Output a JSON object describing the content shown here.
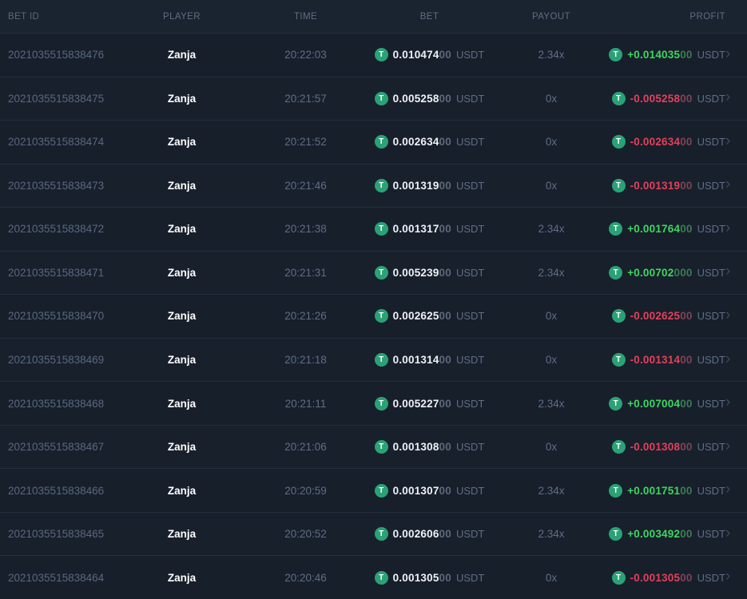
{
  "table": {
    "columns": {
      "bet_id": "BET ID",
      "player": "PLAYER",
      "time": "TIME",
      "bet": "BET",
      "payout": "PAYOUT",
      "profit": "PROFIT"
    },
    "currency": "USDT",
    "icons": {
      "coin": "tether-usdt-icon",
      "coin_glyph": "T",
      "chevron_glyph": "›"
    },
    "colors": {
      "accent_green": "#2ba275",
      "profit_positive": "#3fd65f",
      "profit_negative": "#e3405a",
      "row_background": "#18202c",
      "header_background": "#1a2330",
      "muted_text": "#5e6e85"
    },
    "rows": [
      {
        "id": "2021035515838476",
        "player": "Zanja",
        "time": "20:22:03",
        "bet_main": "0.010474",
        "bet_zeros": "00",
        "payout": "2.34x",
        "profit_main": "+0.014035",
        "profit_zeros": "00",
        "positive": true
      },
      {
        "id": "2021035515838475",
        "player": "Zanja",
        "time": "20:21:57",
        "bet_main": "0.005258",
        "bet_zeros": "00",
        "payout": "0x",
        "profit_main": "-0.005258",
        "profit_zeros": "00",
        "positive": false
      },
      {
        "id": "2021035515838474",
        "player": "Zanja",
        "time": "20:21:52",
        "bet_main": "0.002634",
        "bet_zeros": "00",
        "payout": "0x",
        "profit_main": "-0.002634",
        "profit_zeros": "00",
        "positive": false
      },
      {
        "id": "2021035515838473",
        "player": "Zanja",
        "time": "20:21:46",
        "bet_main": "0.001319",
        "bet_zeros": "00",
        "payout": "0x",
        "profit_main": "-0.001319",
        "profit_zeros": "00",
        "positive": false
      },
      {
        "id": "2021035515838472",
        "player": "Zanja",
        "time": "20:21:38",
        "bet_main": "0.001317",
        "bet_zeros": "00",
        "payout": "2.34x",
        "profit_main": "+0.001764",
        "profit_zeros": "00",
        "positive": true
      },
      {
        "id": "2021035515838471",
        "player": "Zanja",
        "time": "20:21:31",
        "bet_main": "0.005239",
        "bet_zeros": "00",
        "payout": "2.34x",
        "profit_main": "+0.00702",
        "profit_zeros": "000",
        "positive": true
      },
      {
        "id": "2021035515838470",
        "player": "Zanja",
        "time": "20:21:26",
        "bet_main": "0.002625",
        "bet_zeros": "00",
        "payout": "0x",
        "profit_main": "-0.002625",
        "profit_zeros": "00",
        "positive": false
      },
      {
        "id": "2021035515838469",
        "player": "Zanja",
        "time": "20:21:18",
        "bet_main": "0.001314",
        "bet_zeros": "00",
        "payout": "0x",
        "profit_main": "-0.001314",
        "profit_zeros": "00",
        "positive": false
      },
      {
        "id": "2021035515838468",
        "player": "Zanja",
        "time": "20:21:11",
        "bet_main": "0.005227",
        "bet_zeros": "00",
        "payout": "2.34x",
        "profit_main": "+0.007004",
        "profit_zeros": "00",
        "positive": true
      },
      {
        "id": "2021035515838467",
        "player": "Zanja",
        "time": "20:21:06",
        "bet_main": "0.001308",
        "bet_zeros": "00",
        "payout": "0x",
        "profit_main": "-0.001308",
        "profit_zeros": "00",
        "positive": false
      },
      {
        "id": "2021035515838466",
        "player": "Zanja",
        "time": "20:20:59",
        "bet_main": "0.001307",
        "bet_zeros": "00",
        "payout": "2.34x",
        "profit_main": "+0.001751",
        "profit_zeros": "00",
        "positive": true
      },
      {
        "id": "2021035515838465",
        "player": "Zanja",
        "time": "20:20:52",
        "bet_main": "0.002606",
        "bet_zeros": "00",
        "payout": "2.34x",
        "profit_main": "+0.003492",
        "profit_zeros": "00",
        "positive": true
      },
      {
        "id": "2021035515838464",
        "player": "Zanja",
        "time": "20:20:46",
        "bet_main": "0.001305",
        "bet_zeros": "00",
        "payout": "0x",
        "profit_main": "-0.001305",
        "profit_zeros": "00",
        "positive": false
      }
    ]
  }
}
